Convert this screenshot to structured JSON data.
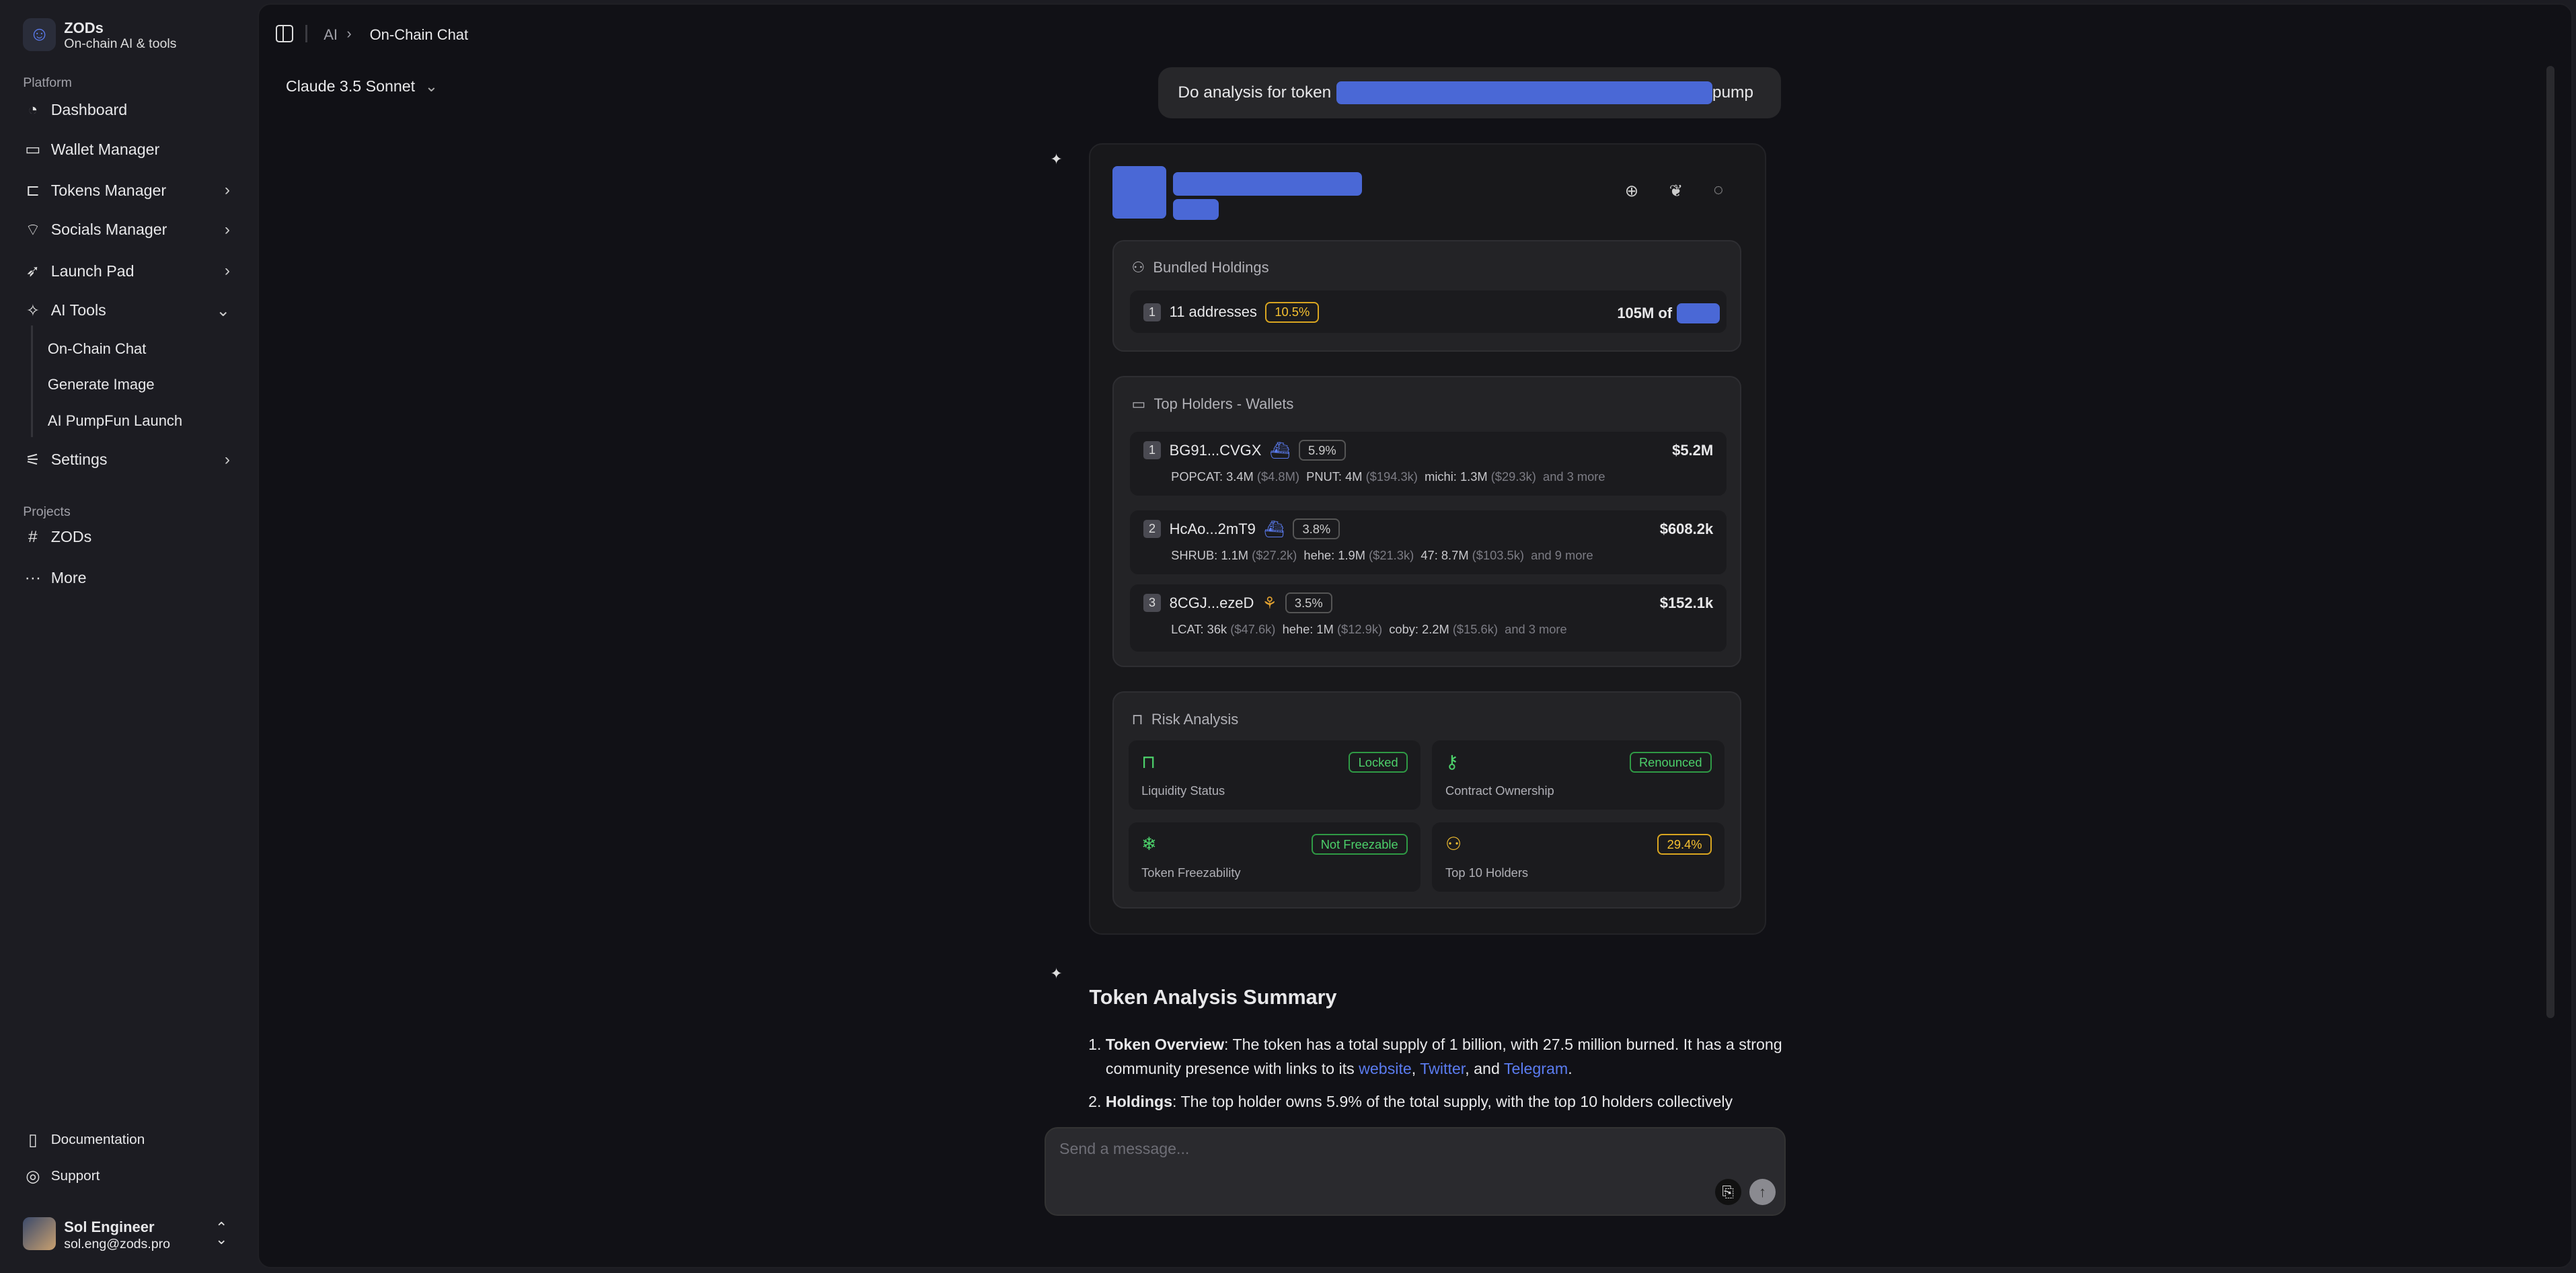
{
  "sidebar": {
    "brand": {
      "name": "ZODs",
      "tagline": "On-chain AI & tools"
    },
    "platform_label": "Platform",
    "items": [
      {
        "label": "Dashboard",
        "icon": "pie-chart-icon"
      },
      {
        "label": "Wallet Manager",
        "icon": "wallet-icon"
      },
      {
        "label": "Tokens Manager",
        "icon": "tree-icon",
        "chevron": "right"
      },
      {
        "label": "Socials Manager",
        "icon": "radio-tower-icon",
        "chevron": "right"
      },
      {
        "label": "Launch Pad",
        "icon": "rocket-icon",
        "chevron": "right"
      },
      {
        "label": "AI Tools",
        "icon": "sparkles-icon",
        "chevron": "down",
        "expanded": true
      },
      {
        "label": "Settings",
        "icon": "sliders-icon",
        "chevron": "right"
      }
    ],
    "ai_tools_sub": [
      "On-Chain Chat",
      "Generate Image",
      "AI PumpFun Launch"
    ],
    "projects_label": "Projects",
    "projects": [
      {
        "label": "ZODs",
        "icon": "frame-icon"
      },
      {
        "label": "More",
        "icon": "more-icon"
      }
    ],
    "footer": [
      {
        "label": "Documentation",
        "icon": "book-icon"
      },
      {
        "label": "Support",
        "icon": "life-buoy-icon"
      }
    ],
    "user": {
      "name": "Sol Engineer",
      "email": "sol.eng@zods.pro"
    }
  },
  "header": {
    "breadcrumb": [
      "AI",
      "On-Chain Chat"
    ]
  },
  "model_selector": {
    "value": "Claude 3.5 Sonnet"
  },
  "chat": {
    "user_message": {
      "prefix": "Do analysis for token",
      "suffix": "pump"
    },
    "token_card": {
      "links": [
        "globe-icon",
        "twitter-icon",
        "message-circle-icon"
      ],
      "bundled": {
        "title": "Bundled Holdings",
        "rank": "1",
        "addresses": "11 addresses",
        "pct": "10.5%",
        "amount": "105M of"
      },
      "top_holders": {
        "title": "Top Holders - Wallets",
        "rows": [
          {
            "rank": "1",
            "addr": "BG91...CVGX",
            "icon": "whale-icon",
            "pct": "5.9%",
            "value": "$5.2M",
            "tokens": [
              [
                "POPCAT: 3.4M",
                "($4.8M)"
              ],
              [
                "PNUT: 4M",
                "($194.3k)"
              ],
              [
                "michi: 1.3M",
                "($29.3k)"
              ]
            ],
            "more": "and 3 more"
          },
          {
            "rank": "2",
            "addr": "HcAo...2mT9",
            "icon": "whale-icon",
            "pct": "3.8%",
            "value": "$608.2k",
            "tokens": [
              [
                "SHRUB: 1.1M",
                "($27.2k)"
              ],
              [
                "hehe: 1.9M",
                "($21.3k)"
              ],
              [
                "47: 8.7M",
                "($103.5k)"
              ]
            ],
            "more": "and 9 more"
          },
          {
            "rank": "3",
            "addr": "8CGJ...ezeD",
            "icon": "dolphin-icon",
            "pct": "3.5%",
            "value": "$152.1k",
            "tokens": [
              [
                "LCAT: 36k",
                "($47.6k)"
              ],
              [
                "hehe: 1M",
                "($12.9k)"
              ],
              [
                "coby: 2.2M",
                "($15.6k)"
              ]
            ],
            "more": "and 3 more"
          }
        ]
      },
      "risk": {
        "title": "Risk Analysis",
        "cells": [
          {
            "label": "Liquidity Status",
            "badge": "Locked",
            "status": "green",
            "icon": "lock-icon"
          },
          {
            "label": "Contract Ownership",
            "badge": "Renounced",
            "status": "green",
            "icon": "key-icon"
          },
          {
            "label": "Token Freezability",
            "badge": "Not Freezable",
            "status": "green",
            "icon": "snowflake-icon"
          },
          {
            "label": "Top 10 Holders",
            "badge": "29.4%",
            "status": "yellow",
            "icon": "users-icon"
          }
        ]
      }
    },
    "summary": {
      "title": "Token Analysis Summary",
      "items": [
        {
          "bold": "Token Overview",
          "text": ": The token has a total supply of 1 billion, with 27.5 million burned. It has a strong community presence with links to its ",
          "links": [
            "website",
            "Twitter",
            "Telegram"
          ],
          "sep1": ", ",
          "sep2": ", and ",
          "end": "."
        },
        {
          "bold": "Holdings",
          "text": ": The top holder owns 5.9% of the total supply, with the top 10 holders collectively"
        }
      ]
    }
  },
  "composer": {
    "placeholder": "Send a message...",
    "attach_icon": "paperclip-icon",
    "send_icon": "arrow-up-icon"
  },
  "colors": {
    "accent": "#4a68d6",
    "green": "#4cd06a",
    "yellow": "#f5c030",
    "bg": "#111116",
    "sidebar": "#1c1c22"
  }
}
